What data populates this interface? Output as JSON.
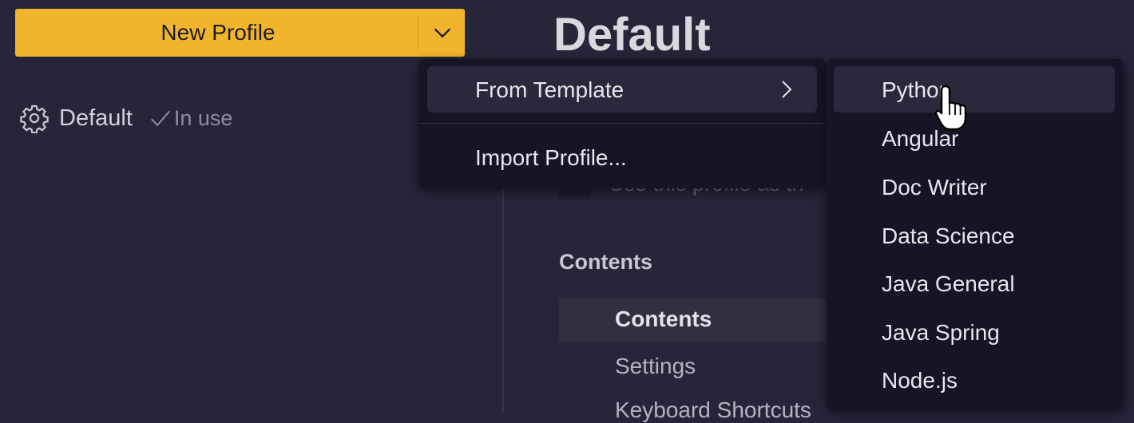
{
  "left": {
    "new_profile_label": "New Profile",
    "profile": {
      "name": "Default",
      "status": "In use"
    }
  },
  "main": {
    "title": "Default",
    "partial_option_text": "Use this profile as th",
    "contents_heading": "Contents",
    "contents_items": [
      "Contents",
      "Settings",
      "Keyboard Shortcuts"
    ]
  },
  "dropdown": {
    "from_template": "From Template",
    "import_profile": "Import Profile..."
  },
  "templates": [
    "Python",
    "Angular",
    "Doc Writer",
    "Data Science",
    "Java General",
    "Java Spring",
    "Node.js"
  ],
  "colors": {
    "accent": "#f0b52c",
    "background": "#272639",
    "menu": "#151525",
    "menu_highlight": "#29293b"
  },
  "icons": [
    "chevron-down-icon",
    "gear-icon",
    "check-icon",
    "chevron-right-icon",
    "hand-pointer-cursor-icon"
  ]
}
